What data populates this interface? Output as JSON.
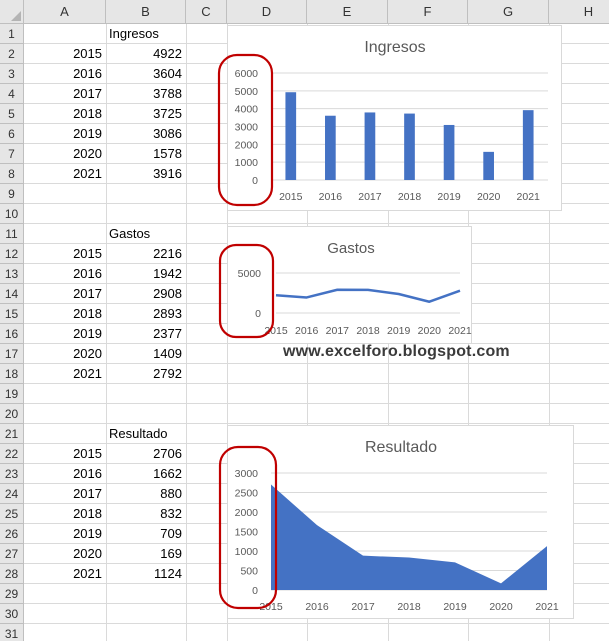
{
  "columns": [
    "A",
    "B",
    "C",
    "D",
    "E",
    "F",
    "G",
    "H"
  ],
  "rows": [
    "1",
    "2",
    "3",
    "4",
    "5",
    "6",
    "7",
    "8",
    "9",
    "10",
    "11",
    "12",
    "13",
    "14",
    "15",
    "16",
    "17",
    "18",
    "19",
    "20",
    "21",
    "22",
    "23",
    "24",
    "25",
    "26",
    "27",
    "28",
    "29",
    "30",
    "31"
  ],
  "tables": {
    "ingresos": {
      "header": "Ingresos",
      "rows": [
        [
          "2015",
          "4922"
        ],
        [
          "2016",
          "3604"
        ],
        [
          "2017",
          "3788"
        ],
        [
          "2018",
          "3725"
        ],
        [
          "2019",
          "3086"
        ],
        [
          "2020",
          "1578"
        ],
        [
          "2021",
          "3916"
        ]
      ]
    },
    "gastos": {
      "header": "Gastos",
      "rows": [
        [
          "2015",
          "2216"
        ],
        [
          "2016",
          "1942"
        ],
        [
          "2017",
          "2908"
        ],
        [
          "2018",
          "2893"
        ],
        [
          "2019",
          "2377"
        ],
        [
          "2020",
          "1409"
        ],
        [
          "2021",
          "2792"
        ]
      ]
    },
    "resultado": {
      "header": "Resultado",
      "rows": [
        [
          "2015",
          "2706"
        ],
        [
          "2016",
          "1662"
        ],
        [
          "2017",
          "880"
        ],
        [
          "2018",
          "832"
        ],
        [
          "2019",
          "709"
        ],
        [
          "2020",
          "169"
        ],
        [
          "2021",
          "1124"
        ]
      ]
    }
  },
  "watermark": "www.excelforo.blogspot.com",
  "colors": {
    "series": "#4472c4",
    "highlight": "#c00000",
    "grid": "#d9d9d9",
    "axis_text": "#595959"
  },
  "chart_data": [
    {
      "type": "bar",
      "title": "Ingresos",
      "categories": [
        "2015",
        "2016",
        "2017",
        "2018",
        "2019",
        "2020",
        "2021"
      ],
      "values": [
        4922,
        3604,
        3788,
        3725,
        3086,
        1578,
        3916
      ],
      "ylim": [
        0,
        6000
      ],
      "yticks": [
        "6000",
        "5000",
        "4000",
        "3000",
        "2000",
        "1000",
        "0"
      ],
      "grid": true
    },
    {
      "type": "line",
      "title": "Gastos",
      "categories": [
        "2015",
        "2016",
        "2017",
        "2018",
        "2019",
        "2020",
        "2021"
      ],
      "values": [
        2216,
        1942,
        2908,
        2893,
        2377,
        1409,
        2792
      ],
      "ylim": [
        0,
        5000
      ],
      "yticks": [
        "5000",
        "0"
      ],
      "grid": true
    },
    {
      "type": "area",
      "title": "Resultado",
      "categories": [
        "2015",
        "2016",
        "2017",
        "2018",
        "2019",
        "2020",
        "2021"
      ],
      "values": [
        2706,
        1662,
        880,
        832,
        709,
        169,
        1124
      ],
      "ylim": [
        0,
        3000
      ],
      "yticks": [
        "3000",
        "2500",
        "2000",
        "1500",
        "1000",
        "500",
        "0"
      ],
      "grid": true
    }
  ]
}
